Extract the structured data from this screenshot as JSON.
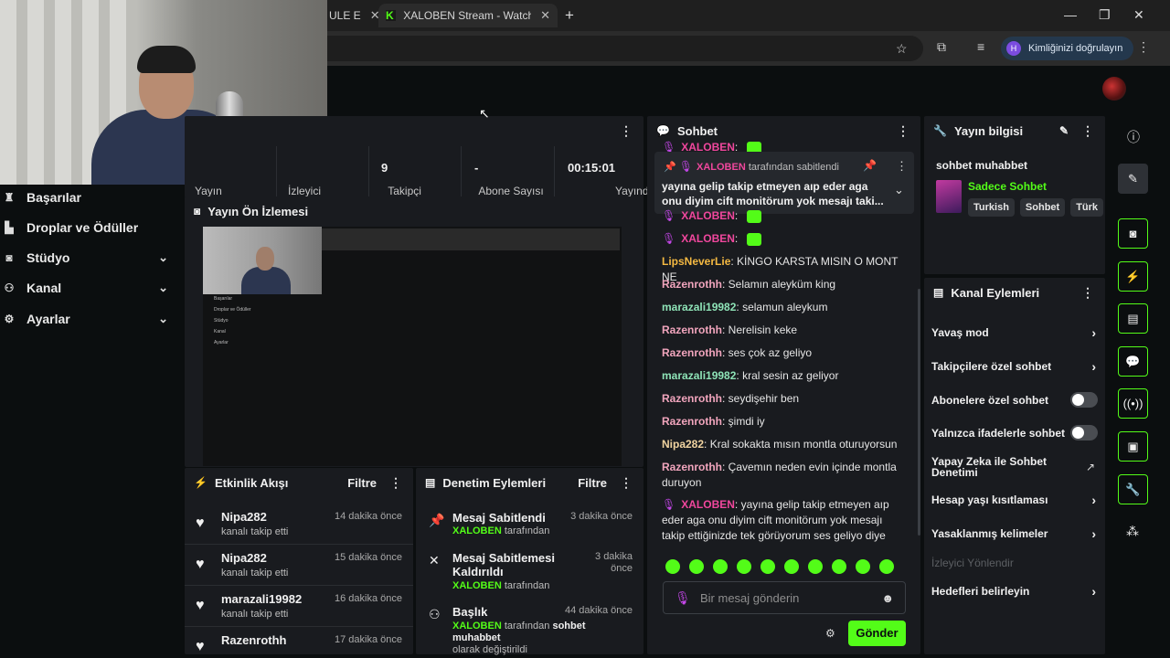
{
  "browser": {
    "tab1_label": "ULE E",
    "tab2_label": "XALOBEN Stream - Watch Live c",
    "tab_close": "✕",
    "new_tab": "+",
    "min": "—",
    "max": "❐",
    "close": "✕",
    "profile_initial": "H",
    "profile_label": "Kimliğinizi doğrulayın"
  },
  "sidebar": {
    "items": [
      {
        "label": "Başarılar",
        "icon": "trophy-icon"
      },
      {
        "label": "Droplar ve Ödüller",
        "icon": "chart-icon"
      },
      {
        "label": "Stüdyo",
        "icon": "camera-icon"
      },
      {
        "label": "Kanal",
        "icon": "users-icon"
      },
      {
        "label": "Ayarlar",
        "icon": "gear-icon"
      }
    ]
  },
  "stats": [
    {
      "value": "",
      "label": "Yayın"
    },
    {
      "value": "",
      "label": "İzleyici"
    },
    {
      "value": "9",
      "label": "Takipçi"
    },
    {
      "value": "-",
      "label": "Abone Sayısı"
    },
    {
      "value": "00:15:01",
      "label": "Yayında"
    }
  ],
  "preview": {
    "title": "Yayın Ön İzlemesi",
    "mini_items": [
      "Başarılar",
      "Droplar ve Ödüller",
      "Stüdyo",
      "Kanal",
      "Ayarlar"
    ]
  },
  "activity": {
    "title": "Etkinlik Akışı",
    "filter": "Filtre",
    "items": [
      {
        "name": "Nipa282",
        "sub": "kanalı takip etti",
        "time": "14 dakika önce"
      },
      {
        "name": "Nipa282",
        "sub": "kanalı takip etti",
        "time": "15 dakika önce"
      },
      {
        "name": "marazali19982",
        "sub": "kanalı takip etti",
        "time": "16 dakika önce"
      },
      {
        "name": "Razenrothh",
        "sub": "",
        "time": "17 dakika önce"
      }
    ]
  },
  "moderation": {
    "title": "Denetim Eylemleri",
    "filter": "Filtre",
    "items": [
      {
        "title": "Mesaj Sabitlendi",
        "time": "3 dakika önce",
        "by_user": "XALOBEN",
        "by_text": "tarafından"
      },
      {
        "title_l1": "Mesaj Sabitlemesi",
        "title_l2": "Kaldırıldı",
        "time_l1": "3 dakika",
        "time_l2": "önce",
        "by_user": "XALOBEN",
        "by_text": "tarafından"
      },
      {
        "title": "Başlık",
        "time": "44 dakika önce",
        "by_user": "XALOBEN",
        "by_text1": "tarafından",
        "by_bold": "sohbet muhabbet",
        "by_text2": "olarak değiştirildi"
      }
    ]
  },
  "chat": {
    "title": "Sohbet",
    "pinned_user": "XALOBEN",
    "pinned_by": "tarafından sabitlendi",
    "pinned_msg": "yayına gelip takip etmeyen aıp eder aga onu diyim cift monitörum yok mesajı taki...",
    "messages": [
      {
        "user": "XALOBEN",
        "text": ""
      },
      {
        "user": "XALOBEN",
        "text": ""
      },
      {
        "user": "XALOBEN",
        "text": ""
      },
      {
        "user": "LipsNeverLie",
        "text": "KİNGO KARSTA MISIN O MONT NE"
      },
      {
        "user": "Razenrothh",
        "text": "Selamın aleyküm king"
      },
      {
        "user": "marazali19982",
        "text": "selamun aleykum"
      },
      {
        "user": "Razenrothh",
        "text": "Nerelisin keke"
      },
      {
        "user": "Razenrothh",
        "text": "ses çok az geliyo"
      },
      {
        "user": "marazali19982",
        "text": "kral sesin az geliyor"
      },
      {
        "user": "Razenrothh",
        "text": "seydişehir ben"
      },
      {
        "user": "Razenrothh",
        "text": "şimdi iy"
      },
      {
        "user": "Nipa282",
        "text": "Kral sokakta mısın montla oturuyorsun"
      },
      {
        "user": "Razenrothh",
        "text": "Çavemın neden evin içinde montla duruyon"
      },
      {
        "user": "XALOBEN",
        "text": "yayına gelip takip etmeyen aıp eder aga onu diyim cift monitörum yok mesajı takip ettiğinizde tek görüyorum ses geliyo diye"
      }
    ],
    "placeholder": "Bir mesaj gönderin",
    "send": "Gönder"
  },
  "stream_info": {
    "title": "Yayın bilgisi",
    "stream_title": "sohbet muhabbet",
    "category": "Sadece Sohbet",
    "tags": [
      "Turkish",
      "Sohbet",
      "Türk"
    ]
  },
  "channel_actions": {
    "title": "Kanal Eylemleri",
    "items": [
      {
        "label": "Yavaş mod",
        "control": "chevron"
      },
      {
        "label": "Takipçilere özel sohbet",
        "control": "chevron"
      },
      {
        "label": "Abonelere özel sohbet",
        "control": "toggle",
        "on": false
      },
      {
        "label": "Yalnızca ifadelerle sohbet",
        "control": "toggle",
        "on": false
      },
      {
        "label": "Yapay Zeka ile Sohbet Denetimi",
        "control": "external"
      },
      {
        "label": "Hesap yaşı kısıtlaması",
        "control": "chevron"
      },
      {
        "label": "Yasaklanmış kelimeler",
        "control": "chevron"
      },
      {
        "label": "İzleyici Yönlendir",
        "control": "none",
        "disabled": true
      },
      {
        "label": "Hedefleri belirleyin",
        "control": "chevron"
      }
    ]
  },
  "colors": {
    "accent": "#53fc18",
    "xaloben": "#f0479d",
    "razenrothh": "#f1a5bd",
    "marazali": "#8ee3b7",
    "lips": "#f4b942",
    "nipa": "#f0d3a0"
  }
}
